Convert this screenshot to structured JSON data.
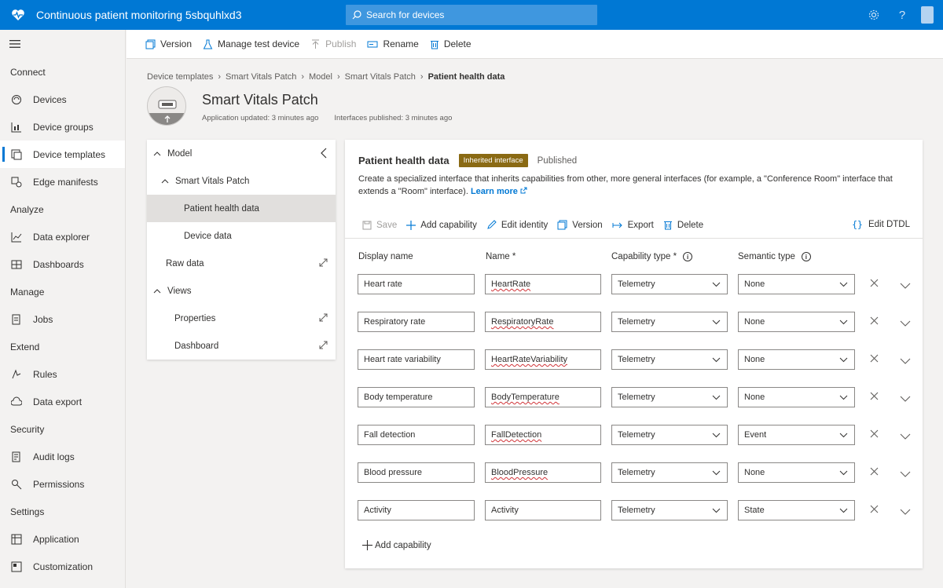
{
  "app": {
    "title": "Continuous patient monitoring 5sbquhlxd3",
    "search_placeholder": "Search for devices"
  },
  "topbar": {
    "icons": [
      "gear-icon",
      "help-icon",
      "account-icon"
    ]
  },
  "sidebar": {
    "sections": [
      {
        "label": "Connect",
        "items": [
          {
            "label": "Devices",
            "icon": "devices-icon"
          },
          {
            "label": "Device groups",
            "icon": "device-groups-icon"
          },
          {
            "label": "Device templates",
            "icon": "device-templates-icon",
            "active": true
          },
          {
            "label": "Edge manifests",
            "icon": "edge-manifests-icon"
          }
        ]
      },
      {
        "label": "Analyze",
        "items": [
          {
            "label": "Data explorer",
            "icon": "data-explorer-icon"
          },
          {
            "label": "Dashboards",
            "icon": "dashboards-icon"
          }
        ]
      },
      {
        "label": "Manage",
        "items": [
          {
            "label": "Jobs",
            "icon": "jobs-icon"
          }
        ]
      },
      {
        "label": "Extend",
        "items": [
          {
            "label": "Rules",
            "icon": "rules-icon"
          },
          {
            "label": "Data export",
            "icon": "data-export-icon"
          }
        ]
      },
      {
        "label": "Security",
        "items": [
          {
            "label": "Audit logs",
            "icon": "audit-logs-icon"
          },
          {
            "label": "Permissions",
            "icon": "permissions-icon"
          }
        ]
      },
      {
        "label": "Settings",
        "items": [
          {
            "label": "Application",
            "icon": "application-icon"
          },
          {
            "label": "Customization",
            "icon": "customization-icon"
          }
        ]
      }
    ]
  },
  "toolbar": {
    "version": "Version",
    "manage_test_device": "Manage test device",
    "publish": "Publish",
    "rename": "Rename",
    "delete": "Delete"
  },
  "breadcrumb": [
    "Device templates",
    "Smart Vitals Patch",
    "Model",
    "Smart Vitals Patch",
    "Patient health data"
  ],
  "device": {
    "title": "Smart Vitals Patch",
    "app_updated": "Application updated: 3 minutes ago",
    "interfaces_published": "Interfaces published: 3 minutes ago"
  },
  "tree": {
    "model": "Model",
    "smart_vitals_patch": "Smart Vitals Patch",
    "patient_health_data": "Patient health data",
    "device_data": "Device data",
    "raw_data": "Raw data",
    "views": "Views",
    "properties": "Properties",
    "dashboard": "Dashboard"
  },
  "panel": {
    "title": "Patient health data",
    "badge": "Inherited interface",
    "status": "Published",
    "desc_line1": "Create a specialized interface that inherits capabilities from other, more general interfaces (for example, a \"Conference Room\" interface that",
    "desc_line2": "extends a \"Room\" interface).",
    "learn_more": "Learn more",
    "commands": {
      "save": "Save",
      "add_capability": "Add capability",
      "edit_identity": "Edit identity",
      "version": "Version",
      "export": "Export",
      "delete": "Delete",
      "edit_dtdl": "Edit DTDL"
    },
    "headers": {
      "display_name": "Display name",
      "name": "Name *",
      "capability_type": "Capability type *",
      "semantic_type": "Semantic type"
    },
    "rows": [
      {
        "display_name": "Heart rate",
        "name": "HeartRate",
        "capability_type": "Telemetry",
        "semantic_type": "None"
      },
      {
        "display_name": "Respiratory rate",
        "name": "RespiratoryRate",
        "capability_type": "Telemetry",
        "semantic_type": "None"
      },
      {
        "display_name": "Heart rate variability",
        "name": "HeartRateVariability",
        "capability_type": "Telemetry",
        "semantic_type": "None"
      },
      {
        "display_name": "Body temperature",
        "name": "BodyTemperature",
        "capability_type": "Telemetry",
        "semantic_type": "None"
      },
      {
        "display_name": "Fall detection",
        "name": "FallDetection",
        "capability_type": "Telemetry",
        "semantic_type": "Event"
      },
      {
        "display_name": "Blood pressure",
        "name": "BloodPressure",
        "capability_type": "Telemetry",
        "semantic_type": "None"
      },
      {
        "display_name": "Activity",
        "name": "Activity",
        "capability_type": "Telemetry",
        "semantic_type": "State"
      }
    ],
    "add_capability_footer": "Add capability"
  },
  "colors": {
    "accent": "#0078d4",
    "badge": "#8a6a14",
    "selection": "#e1dfdd"
  }
}
